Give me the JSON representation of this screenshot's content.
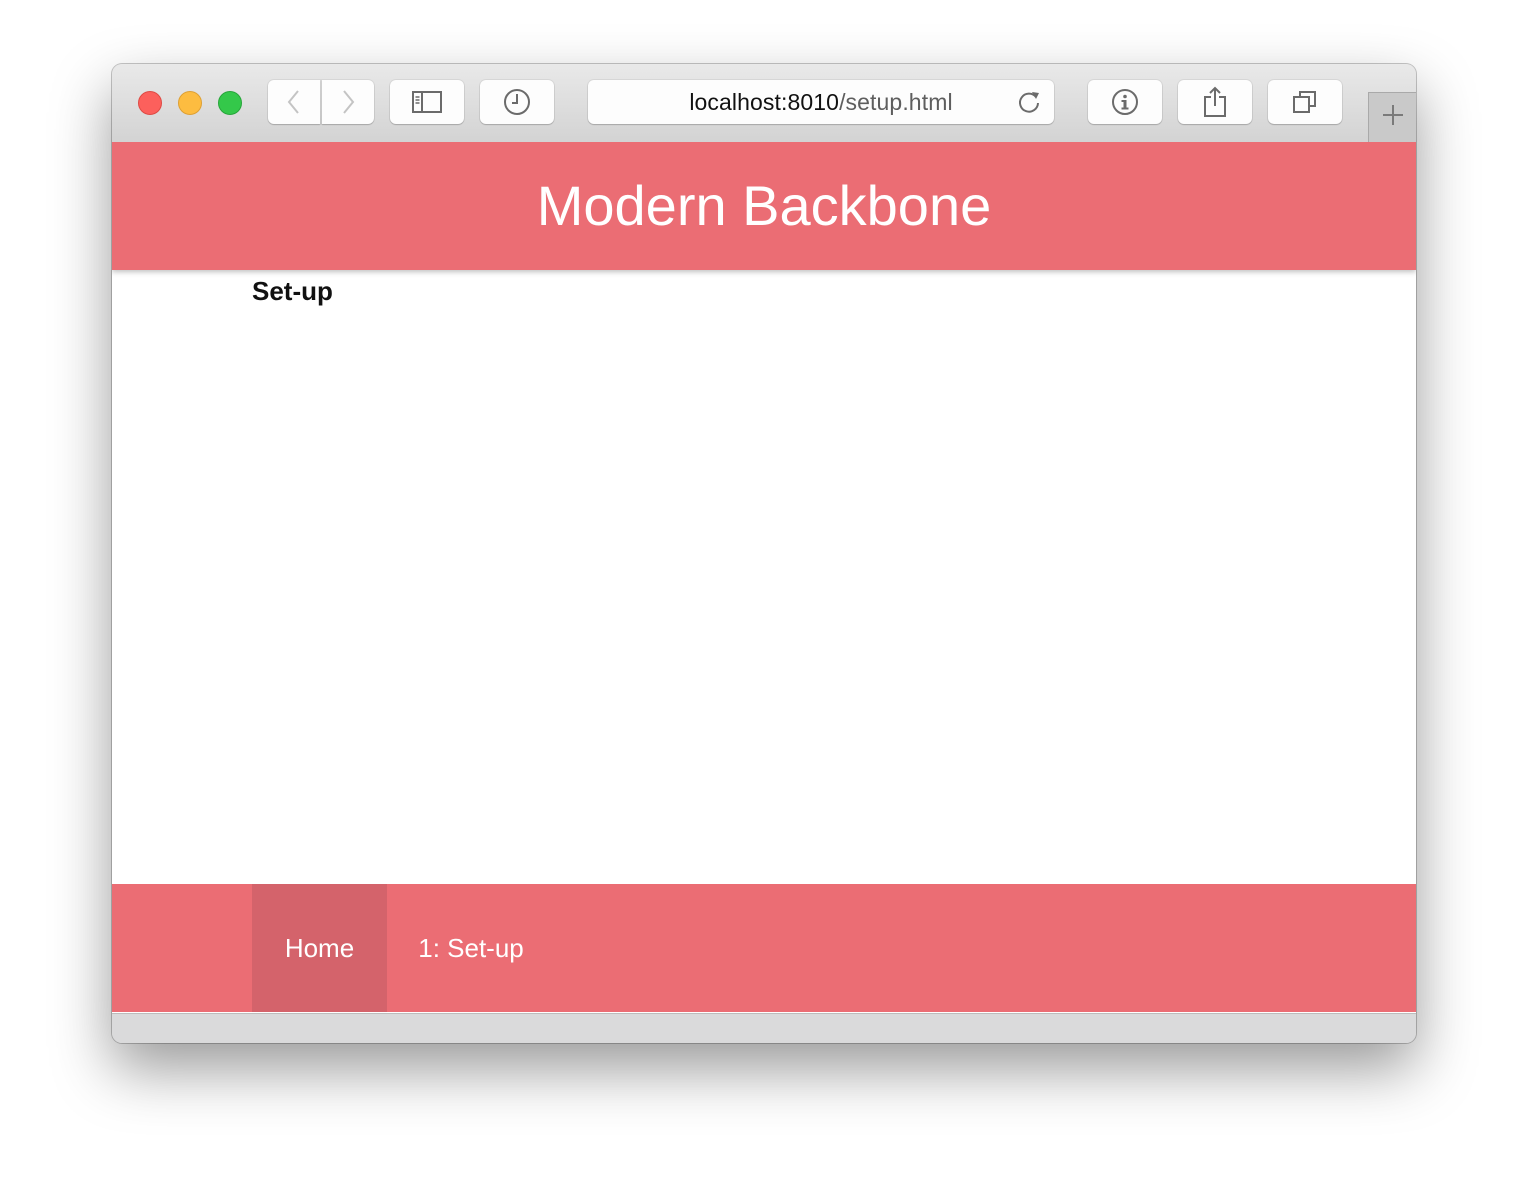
{
  "browser": {
    "url_host": "localhost:8010",
    "url_path": "/setup.html",
    "icons": {
      "close": "traffic-light-close",
      "minimize": "traffic-light-minimize",
      "zoom": "traffic-light-zoom",
      "back": "chevron-left-icon",
      "forward": "chevron-right-icon",
      "sidebar": "sidebar-icon",
      "history": "clock-icon",
      "reload": "reload-icon",
      "info": "info-icon",
      "share": "share-icon",
      "tabs": "tabs-icon",
      "new_tab": "plus-icon"
    }
  },
  "site": {
    "title": "Modern Backbone",
    "accent_color": "#eb6d74",
    "active_nav_color": "#d4636b"
  },
  "main": {
    "heading": "Set-up"
  },
  "footer": {
    "nav": [
      {
        "label": "Home",
        "active": true
      },
      {
        "label": "1: Set-up",
        "active": false
      }
    ]
  }
}
